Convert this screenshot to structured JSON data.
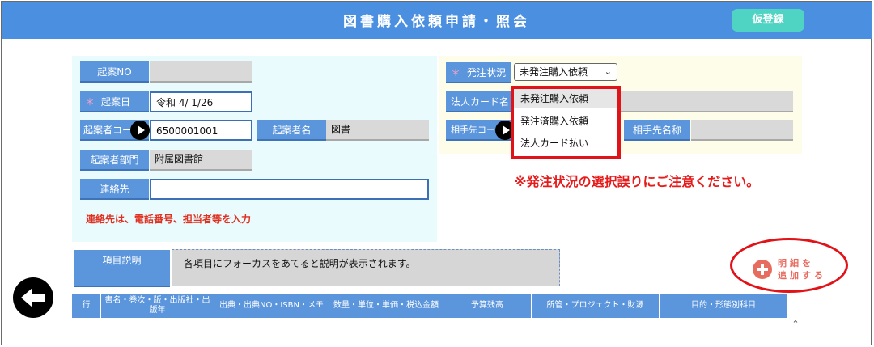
{
  "header": {
    "title": "図書購入依頼申請・照会",
    "kari_button": "仮登録"
  },
  "left_form": {
    "kian_no_label": "起案NO",
    "kian_no_value": "",
    "required_mark": "＊",
    "kian_date_label": "起案日",
    "kian_date_value": "令和 4/ 1/26",
    "kiansha_code_label": "起案者コード",
    "kiansha_code_value": "6500001001",
    "kiansha_name_label": "起案者名",
    "kiansha_name_value": "図書",
    "kiansha_dept_label": "起案者部門",
    "kiansha_dept_value": "附属図書館",
    "contact_label": "連絡先",
    "contact_value": "",
    "contact_note": "連絡先は、電話番号、担当者等を入力"
  },
  "right_form": {
    "order_status_label": "発注状況",
    "order_status_selected": "未発注購入依頼",
    "corp_card_label": "法人カード名",
    "partner_code_label": "相手先コード",
    "partner_name_label": "相手先名称",
    "dropdown_options": [
      "未発注購入依頼",
      "発注済購入依頼",
      "法人カード払い"
    ]
  },
  "warning": "※発注状況の選択誤りにご注意ください。",
  "help": {
    "label": "項目説明",
    "text": "各項目にフォーカスをあてると説明が表示されます。"
  },
  "add_detail": {
    "line1": "明細を",
    "line2": "追加する"
  },
  "table": {
    "columns": [
      "行",
      "書名・巻次・版・出版社・出版年",
      "出典・出典NO・ISBN・メモ",
      "数量・単位・単価・税込金額",
      "予算残高",
      "所管・プロジェクト・財源",
      "目的・形態別科目"
    ]
  },
  "colors": {
    "header": "#4a8fe0",
    "label": "#5b95dc",
    "accent_red": "#e1131a",
    "kari_button": "#4fd3c2"
  }
}
